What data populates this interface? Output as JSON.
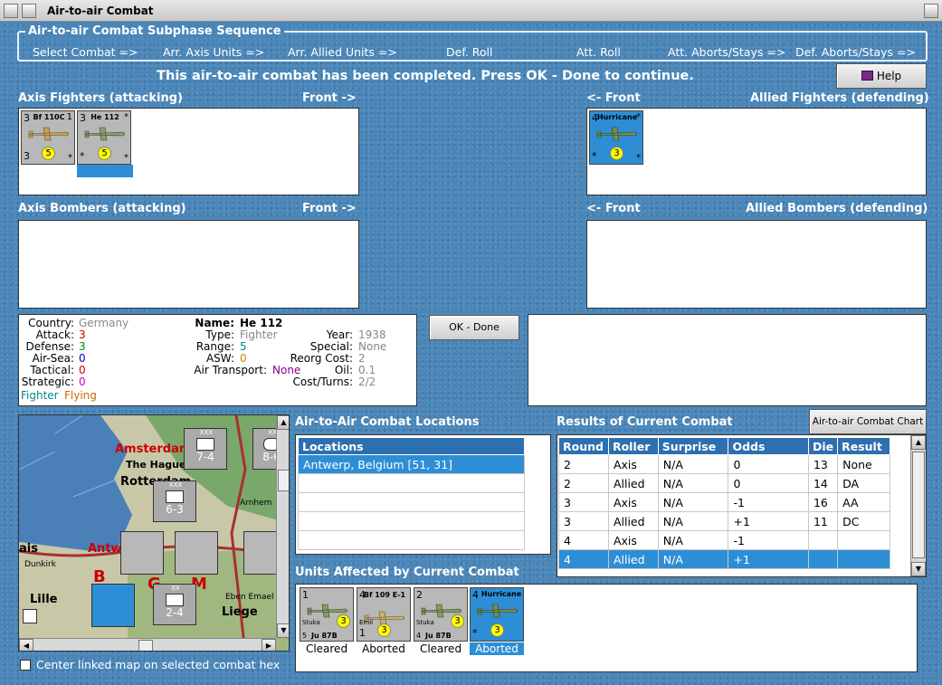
{
  "window": {
    "title": "Air-to-air Combat"
  },
  "sequence": {
    "title": "Air-to-air Combat Subphase Sequence",
    "steps": [
      "Select Combat =>",
      "Arr. Axis Units =>",
      "Arr. Allied Units =>",
      "Def. Roll",
      "Att. Roll",
      "Att. Aborts/Stays =>",
      "Def. Aborts/Stays =>"
    ]
  },
  "message": "This air-to-air combat has been completed.  Press OK - Done to continue.",
  "help_label": "Help",
  "ok_label": "OK - Done",
  "panels": {
    "axis_fighters": "Axis Fighters (attacking)",
    "allied_fighters": "Allied Fighters (defending)",
    "axis_bombers": "Axis Bombers (attacking)",
    "allied_bombers": "Allied Bombers (defending)",
    "front_right": "Front ->",
    "front_left": "<- Front"
  },
  "axis_fighter_units": [
    {
      "name": "Bf 110C",
      "tl": "3",
      "tr": "1",
      "bl": "3",
      "br": "*",
      "dot": "5"
    },
    {
      "name": "He 112",
      "tl": "3",
      "tr": "*",
      "bl": "*",
      "br": "*",
      "dot": "5"
    }
  ],
  "allied_fighter_units": [
    {
      "name": "Hurricane",
      "tl": "4",
      "tr": "*",
      "bl": "*",
      "br": "*",
      "dot": "3"
    }
  ],
  "unit_info": {
    "country_label": "Country:",
    "country": "Germany",
    "attack_label": "Attack:",
    "attack": "3",
    "defense_label": "Defense:",
    "defense": "3",
    "airsea_label": "Air-Sea:",
    "airsea": "0",
    "tactical_label": "Tactical:",
    "tactical": "0",
    "strategic_label": "Strategic:",
    "strategic": "0",
    "status1": "Fighter",
    "status2": "Flying",
    "name_label": "Name:",
    "name": "He 112",
    "type_label": "Type:",
    "type": "Fighter",
    "range_label": "Range:",
    "range": "5",
    "asw_label": "ASW:",
    "asw": "0",
    "airtransport_label": "Air Transport:",
    "airtransport": "None",
    "year_label": "Year:",
    "year": "1938",
    "special_label": "Special:",
    "special": "None",
    "reorg_label": "Reorg Cost:",
    "reorg": "2",
    "oil_label": "Oil:",
    "oil": "0.1",
    "cost_label": "Cost/Turns:",
    "cost": "2/2"
  },
  "map": {
    "places": [
      "Amsterdam",
      "The Hague",
      "Rotterdam",
      "Antw",
      "Dunkirk",
      "Lille",
      "Liege",
      "Eben Emael",
      "Arnhem",
      "ais",
      "B",
      "G",
      "M"
    ],
    "corps": [
      {
        "label": "7-4",
        "side": "XXX"
      },
      {
        "label": "6-3",
        "side": "XXX"
      },
      {
        "label": "2-4",
        "side": "XX"
      },
      {
        "label": "8-6",
        "side": "XX"
      }
    ],
    "checkbox_label": "Center linked map on selected combat hex",
    "checkbox_checked": false
  },
  "locations": {
    "title": "Air-to-Air Combat Locations",
    "header": "Locations",
    "rows": [
      "Antwerp, Belgium [51, 31]",
      "",
      "",
      "",
      "",
      ""
    ]
  },
  "results": {
    "title": "Results of Current Combat",
    "chart_button": "Air-to-air Combat Chart",
    "columns": [
      "Round",
      "Roller",
      "Surprise",
      "Odds",
      "Die",
      "Result"
    ],
    "rows": [
      [
        "2",
        "Axis",
        "N/A",
        "0",
        "13",
        "None"
      ],
      [
        "2",
        "Allied",
        "N/A",
        "0",
        "14",
        "DA"
      ],
      [
        "3",
        "Axis",
        "N/A",
        "-1",
        "16",
        "AA"
      ],
      [
        "3",
        "Allied",
        "N/A",
        "+1",
        "11",
        "DC"
      ],
      [
        "4",
        "Axis",
        "N/A",
        "-1",
        "",
        ""
      ],
      [
        "4",
        "Allied",
        "N/A",
        "+1",
        "",
        ""
      ]
    ]
  },
  "affected": {
    "title": "Units Affected by Current Combat",
    "units": [
      {
        "name": "Ju 87B",
        "sub": "Stuka",
        "tl": "1",
        "bl": "5",
        "dot": "3",
        "status": "Cleared",
        "blue": false
      },
      {
        "name": "Bf 109 E-1",
        "sub": "Emil",
        "tl": "4",
        "bl": "1",
        "dot": "3",
        "status": "Aborted",
        "blue": false
      },
      {
        "name": "Ju 87B",
        "sub": "Stuka",
        "tl": "2",
        "bl": "4",
        "dot": "3",
        "status": "Cleared",
        "blue": false
      },
      {
        "name": "Hurricane",
        "sub": "",
        "tl": "4",
        "bl": "*",
        "dot": "3",
        "status": "Aborted",
        "blue": true
      }
    ]
  },
  "colors": {
    "attack": "#cc0000",
    "defense": "#008800",
    "airsea": "#0000cc",
    "range": "#008888",
    "asw": "#cc8800",
    "airtransport": "#880088",
    "grey": "#888888",
    "fighter": "#008888",
    "flying": "#cc6600",
    "select_blue": "#2d8ed6"
  }
}
